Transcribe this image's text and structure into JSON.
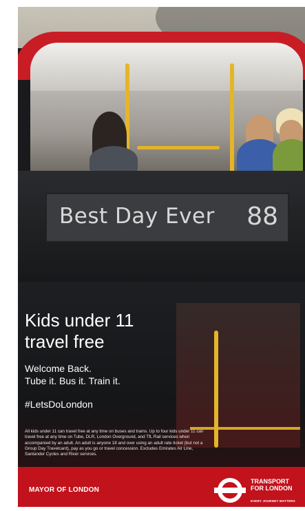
{
  "poster": {
    "destination_text": "Best Day Ever",
    "route_number": "88",
    "headline_line1": "Kids under 11",
    "headline_line2": "travel free",
    "subhead_line1": "Welcome Back.",
    "subhead_line2": "Tube it. Bus it. Train it.",
    "hashtag": "#LetsDoLondon",
    "fine_print": "All kids under 11 can travel free at any time on buses and trams. Up to four kids under 11 can travel free at any time on Tube, DLR, London Overground, and TfL Rail services when accompanied by an adult. An adult is anyone 18 and over using an adult rate ticket (but not a Group Day Travelcard), pay as you go or travel concession. Excludes Emirates Air Line, Santander Cycles and River services.",
    "mayor_label": "MAYOR OF LONDON",
    "tfl_line1": "TRANSPORT",
    "tfl_line2": "FOR LONDON",
    "tfl_tagline": "EVERY JOURNEY MATTERS"
  },
  "colors": {
    "bus_red": "#c81d25",
    "roundel_red": "#dc241f",
    "text_white": "#ffffff"
  },
  "icons": {
    "roundel": "tfl-roundel-icon"
  }
}
